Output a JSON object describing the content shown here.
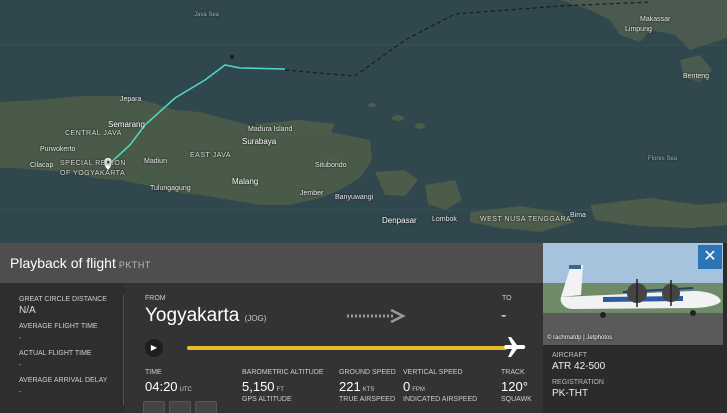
{
  "map": {
    "labels": {
      "java_sea": "Java Sea",
      "makassar": "Makassar",
      "limpung": "Limpung",
      "bengkulu": "Benteng",
      "jepara": "Jepara",
      "semarang": "Semarang",
      "central_java": "CENTRAL JAVA",
      "purwokerto": "Purwokerto",
      "special_region": "SPECIAL REGION",
      "of_yogyakarta": "OF YOGYAKARTA",
      "cilacap": "Cilacap",
      "madiun": "Madiun",
      "east_java": "EAST JAVA",
      "madura": "Madura Island",
      "surabaya": "Surabaya",
      "situbondo": "Situbondo",
      "malang": "Malang",
      "tulungagung": "Tulungagung",
      "jember": "Jember",
      "banyuwangi": "Banyuwangi",
      "denpasar": "Denpasar",
      "lombok": "Lombok",
      "flores_sea": "Flores Sea",
      "west_nusa": "WEST NUSA TENGGARA",
      "bima": "Bima"
    }
  },
  "panel": {
    "title": "Playback of flight",
    "registration_code": "PKTHT",
    "great_circle_label": "GREAT CIRCLE DISTANCE",
    "great_circle_value": "N/A",
    "avg_flight_time_label": "AVERAGE FLIGHT TIME",
    "avg_flight_time_value": "-",
    "actual_flight_time_label": "ACTUAL FLIGHT TIME",
    "actual_flight_time_value": "-",
    "avg_arrival_delay_label": "AVERAGE ARRIVAL DELAY",
    "avg_arrival_delay_value": "-",
    "from_label": "FROM",
    "from_city": "Yogyakarta",
    "from_code": "(JOG)",
    "to_label": "TO",
    "to_value": "-",
    "progress": 1.0,
    "time_label": "TIME",
    "time_value": "04:20",
    "time_unit": "UTC",
    "baro_alt_label": "BAROMETRIC ALTITUDE",
    "baro_alt_value": "5,150",
    "baro_alt_unit": "FT",
    "gps_alt_label": "GPS ALTITUDE",
    "ground_speed_label": "GROUND SPEED",
    "ground_speed_value": "221",
    "ground_speed_unit": "KTS",
    "true_airspeed_label": "TRUE AIRSPEED",
    "vertical_speed_label": "VERTICAL SPEED",
    "vertical_speed_value": "0",
    "vertical_speed_unit": "FPM",
    "indicated_airspeed_label": "INDICATED AIRSPEED",
    "track_label": "TRACK",
    "track_value": "120°",
    "squawk_label": "SQUAWK"
  },
  "aircraft": {
    "photo_credit": "© rachmatdp | Jetphotos",
    "aircraft_label": "AIRCRAFT",
    "aircraft_value": "ATR 42-500",
    "registration_label": "REGISTRATION",
    "registration_value": "PK-THT",
    "close_symbol": "✕"
  },
  "colors": {
    "track_line": "#4fd6c4",
    "progress": "#e8b928",
    "close_button": "#2c74b5"
  }
}
